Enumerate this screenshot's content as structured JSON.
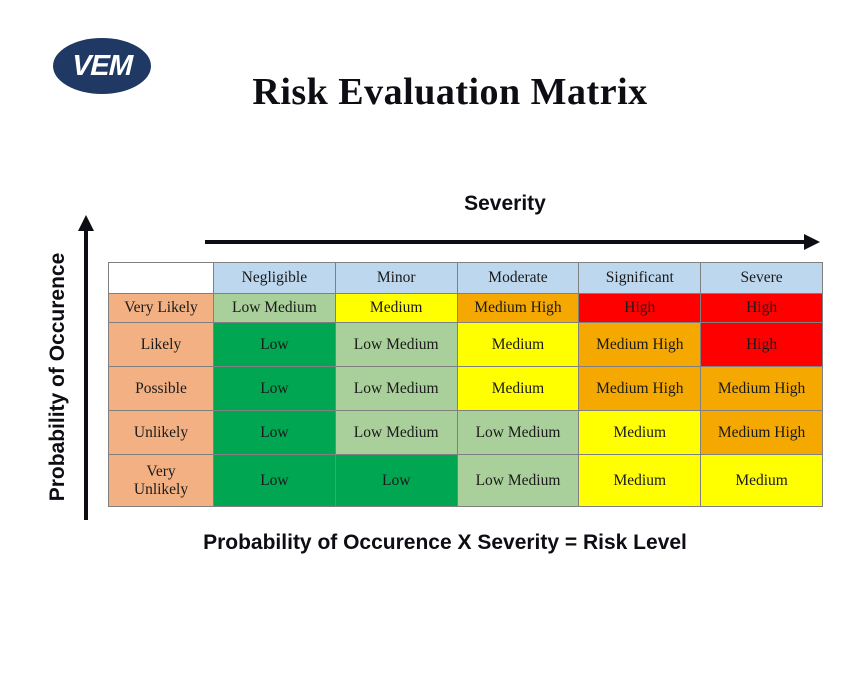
{
  "logo": {
    "text": "VEM",
    "color": "#1F3864"
  },
  "title": "Risk Evaluation Matrix",
  "axes": {
    "x_label": "Severity",
    "y_label": "Probability of Occurence"
  },
  "caption": "Probability of Occurence X Severity = Risk Level",
  "palette": {
    "low": "#00A651",
    "low_medium": "#A9CF9A",
    "medium": "#FFFF00",
    "medium_high": "#F5A800",
    "high": "#FF0000",
    "header_blue": "#BDD7EE",
    "probability_peach": "#F3B183",
    "corner_white": "#FFFFFF",
    "border": "#808080"
  },
  "chart_data": {
    "type": "heatmap",
    "title": "Risk Evaluation Matrix",
    "xlabel": "Severity",
    "ylabel": "Probability of Occurence",
    "corner_label": "",
    "columns": [
      "Negligible",
      "Minor",
      "Moderate",
      "Significant",
      "Severe"
    ],
    "rows": [
      "Very Likely",
      "Likely",
      "Possible",
      "Unlikely",
      "Very Unlikely"
    ],
    "levels": [
      "Low",
      "Low Medium",
      "Medium",
      "Medium High",
      "High"
    ],
    "level_colors": {
      "Low": "#00A651",
      "Low Medium": "#A9CF9A",
      "Medium": "#FFFF00",
      "Medium High": "#F5A800",
      "High": "#FF0000"
    },
    "cells": [
      [
        "Low Medium",
        "Medium",
        "Medium High",
        "High",
        "High"
      ],
      [
        "Low",
        "Low Medium",
        "Medium",
        "Medium High",
        "High"
      ],
      [
        "Low",
        "Low Medium",
        "Medium",
        "Medium High",
        "Medium High"
      ],
      [
        "Low",
        "Low Medium",
        "Low Medium",
        "Medium",
        "Medium High"
      ],
      [
        "Low",
        "Low",
        "Low Medium",
        "Medium",
        "Medium"
      ]
    ],
    "legend": null,
    "grid": true
  }
}
